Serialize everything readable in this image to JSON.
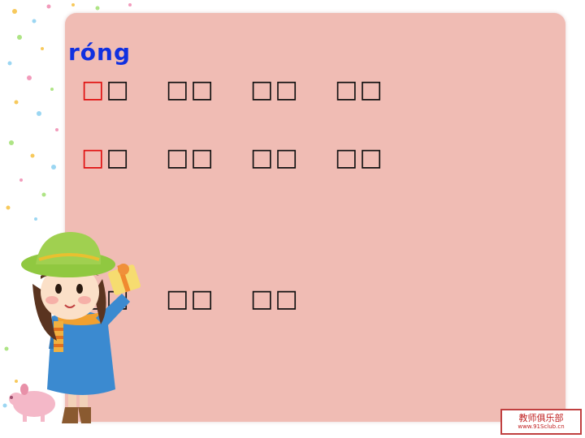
{
  "pinyin": "róng",
  "rows": [
    {
      "words": [
        "□□",
        "□□",
        "□□",
        "□□"
      ],
      "highlight_first": true
    },
    {
      "words": [
        "□□",
        "□□",
        "□□",
        "□□"
      ],
      "highlight_first": true
    },
    {
      "words": [
        "□□",
        "□□",
        "□□"
      ],
      "highlight_first": false
    }
  ],
  "logo": {
    "title": "教师俱乐部",
    "url": "www.91Sclub.cn"
  },
  "colors": {
    "panel": "#f0bcb4",
    "pinyin": "#1030e0",
    "highlight": "#e01010"
  }
}
